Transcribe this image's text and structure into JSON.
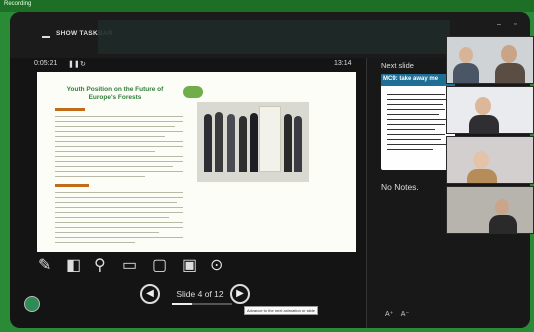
{
  "recording": {
    "label": "Recording"
  },
  "toolbar": {
    "show_taskbar_label": "SHOW TASKBAR",
    "minimize": "–",
    "restore": "▫"
  },
  "timer": {
    "elapsed": "0:05:21",
    "clock": "13:14",
    "pause_icon": "pause-icon",
    "reset_icon": "reset-icon"
  },
  "slide": {
    "title": "Youth Position on the Future of Europe's Forests"
  },
  "tools": [
    "pen-icon",
    "pointer-icon",
    "zoom-icon",
    "screen-icon",
    "subtitles-icon",
    "camera-icon",
    "more-icon"
  ],
  "pager": {
    "prev": "◀",
    "next": "▶",
    "label": "Slide 4 of 12",
    "progress": 0.333
  },
  "tooltip": "Advance to the next animation or slide",
  "next_slide": {
    "heading": "Next slide",
    "title": "MC9: take away me"
  },
  "notes": "No Notes.",
  "font_buttons": {
    "increase": "A⁺",
    "decrease": "A⁻"
  },
  "colors": {
    "frame": "#2a8a36",
    "screen_bg": "#141414",
    "accent": "#2e7d3a",
    "next_title_bg": "#1f6e96"
  }
}
